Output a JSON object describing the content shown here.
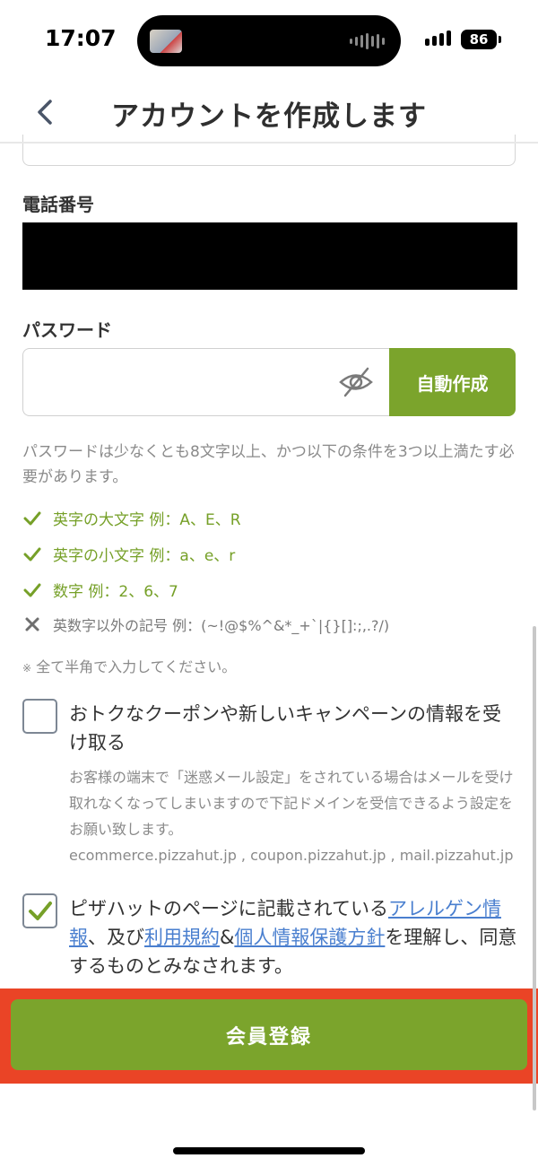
{
  "status_bar": {
    "time": "17:07",
    "battery": "86",
    "signal_icon": "cellular-signal-icon",
    "battery_icon": "battery-icon"
  },
  "header": {
    "title": "アカウントを作成します",
    "back_icon": "chevron-left-icon"
  },
  "phone": {
    "label": "電話番号"
  },
  "password": {
    "label": "パスワード",
    "value": "",
    "visibility_icon": "eye-off-icon",
    "autogen_label": "自動作成",
    "hint": "パスワードは少なくとも8文字以上、かつ以下の条件を3つ以上満たす必要があります。",
    "rules": [
      {
        "text": "英字の大文字 例：A、E、R",
        "met": true
      },
      {
        "text": "英字の小文字 例：a、e、r",
        "met": true
      },
      {
        "text": "数字 例：2、6、7",
        "met": true
      },
      {
        "text": "英数字以外の記号 例：(~!@$%^&*_+`|{}[]:;,.?/)",
        "met": false
      }
    ],
    "note_mark": "※",
    "note": "全て半角で入力してください。"
  },
  "coupon_opt_in": {
    "checked": false,
    "label": "おトクなクーポンや新しいキャンペーンの情報を受け取る",
    "note": "お客様の端末で「迷惑メール設定」をされている場合はメールを受け取れなくなってしまいますので下記ドメインを受信できるよう設定をお願い致します。",
    "domains": "ecommerce.pizzahut.jp , coupon.pizzahut.jp , mail.pizzahut.jp"
  },
  "agreement": {
    "checked": true,
    "text_before": "ピザハットのページに記載されている",
    "link_allergen": "アレルゲン情報",
    "text_mid1": "、及び",
    "link_terms": "利用規約",
    "text_mid2": "&",
    "link_privacy": "個人情報保護方針",
    "text_after": "を理解し、同意するものとみなされます。"
  },
  "register_button": {
    "label": "会員登録"
  },
  "colors": {
    "accent_green": "#7ba42c",
    "rule_ok": "#76a028",
    "highlight_red": "#ea4426",
    "link_blue": "#4a7fcf"
  }
}
